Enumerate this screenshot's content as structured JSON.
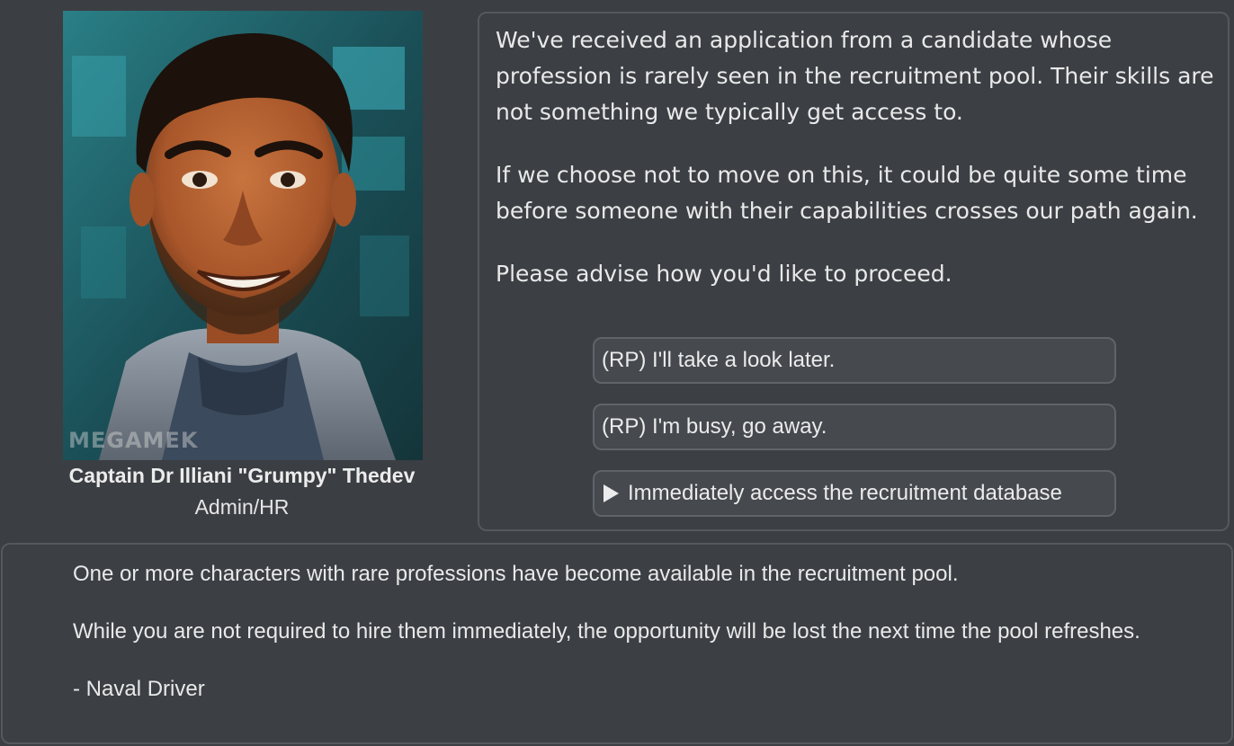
{
  "portrait": {
    "watermark": "MEGAMEK",
    "icon": "character-portrait"
  },
  "speaker": {
    "name": "Captain Dr Illiani \"Grumpy\" Thedev",
    "role": "Admin/HR"
  },
  "dialog": {
    "paragraphs": [
      "We've received an application from a candidate whose profession is rarely seen in the recruitment pool. Their skills are not something we typically get access to.",
      "If we choose not to move on this, it could be quite some time before someone with their capabilities crosses our path again.",
      "Please advise how you'd like to proceed."
    ]
  },
  "choices": [
    {
      "label": "(RP) I'll take a look later.",
      "icon": ""
    },
    {
      "label": "(RP) I'm busy, go away.",
      "icon": ""
    },
    {
      "label": "Immediately access the recruitment database",
      "icon": "play-icon"
    }
  ],
  "info": {
    "paragraphs": [
      "One or more characters with rare professions have become available in the recruitment pool.",
      "While you are not required to hire them immediately, the opportunity will be lost the next time the pool refreshes.",
      "- Naval Driver"
    ]
  },
  "colors": {
    "background": "#3b3e43",
    "panel_border": "#55585d",
    "button_bg": "#46494e",
    "text": "#e9e9e9"
  }
}
